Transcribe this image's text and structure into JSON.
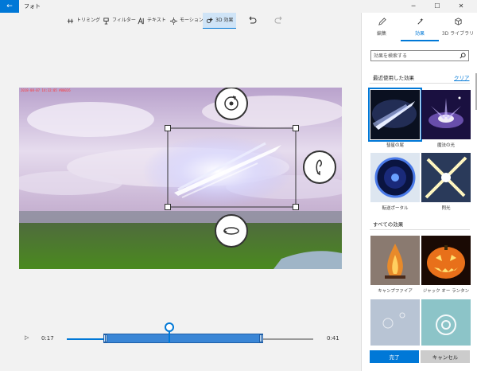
{
  "window": {
    "title": "フォト",
    "back_icon": "arrow-left-icon",
    "minimize": "─",
    "maximize": "☐",
    "close": "✕"
  },
  "toolbar": {
    "trim_label": "トリミング",
    "filter_label": "フィルター",
    "text_label": "テキスト",
    "motion_label": "モーション",
    "effects3d_label": "3D 効果"
  },
  "stage": {
    "timestamp": "2018-08-07 14:32:05 #00026"
  },
  "timeline": {
    "play_icon": "▷",
    "current_time": "0:17",
    "end_time": "0:41"
  },
  "panel": {
    "tabs": [
      {
        "label": "編集",
        "icon": "pencil-icon"
      },
      {
        "label": "効果",
        "icon": "sparkle-icon"
      },
      {
        "label": "3D ライブラリ",
        "icon": "cube-icon"
      }
    ],
    "search_placeholder": "効果を検索する",
    "recent_title": "最近使用した効果",
    "clear_label": "クリア",
    "recent_items": [
      "彗星の尾",
      "魔法の光",
      "転送ポータル",
      "閃光"
    ],
    "all_title": "すべての効果",
    "all_items": [
      "キャンプファイア",
      "ジャック オー ランタン"
    ],
    "done_label": "完了",
    "cancel_label": "キャンセル"
  },
  "colors": {
    "accent": "#0078d7",
    "clip": "#3a86d6"
  }
}
